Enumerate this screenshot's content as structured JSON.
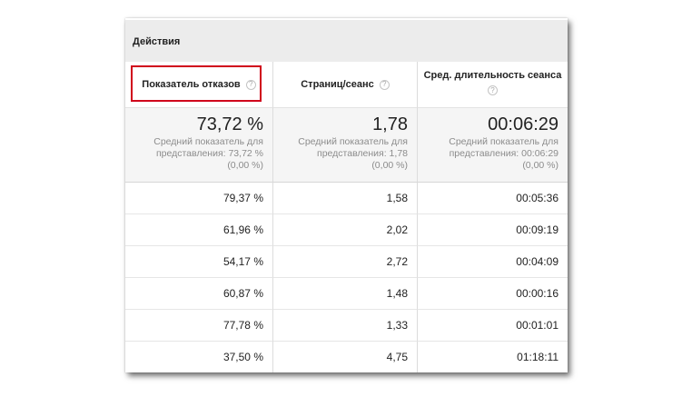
{
  "group_title": "Действия",
  "columns": [
    {
      "header": "Показатель отказов",
      "summary_value": "73,72 %",
      "summary_note": [
        "Средний показатель для",
        "представления: 73,72 %",
        "(0,00 %)"
      ]
    },
    {
      "header": "Страниц/сеанс",
      "summary_value": "1,78",
      "summary_note": [
        "Средний показатель для",
        "представления: 1,78",
        "(0,00 %)"
      ]
    },
    {
      "header": "Сред. длительность сеанса",
      "summary_value": "00:06:29",
      "summary_note": [
        "Средний показатель для",
        "представления: 00:06:29",
        "(0,00 %)"
      ]
    }
  ],
  "help_glyph": "?",
  "rows": [
    [
      "79,37 %",
      "1,58",
      "00:05:36"
    ],
    [
      "61,96 %",
      "2,02",
      "00:09:19"
    ],
    [
      "54,17 %",
      "2,72",
      "00:04:09"
    ],
    [
      "60,87 %",
      "1,48",
      "00:00:16"
    ],
    [
      "77,78 %",
      "1,33",
      "00:01:01"
    ],
    [
      "37,50 %",
      "4,75",
      "01:18:11"
    ]
  ],
  "colors": {
    "highlight_border": "#d0021b",
    "group_header_bg": "#ececec",
    "summary_bg": "#f5f5f5"
  }
}
